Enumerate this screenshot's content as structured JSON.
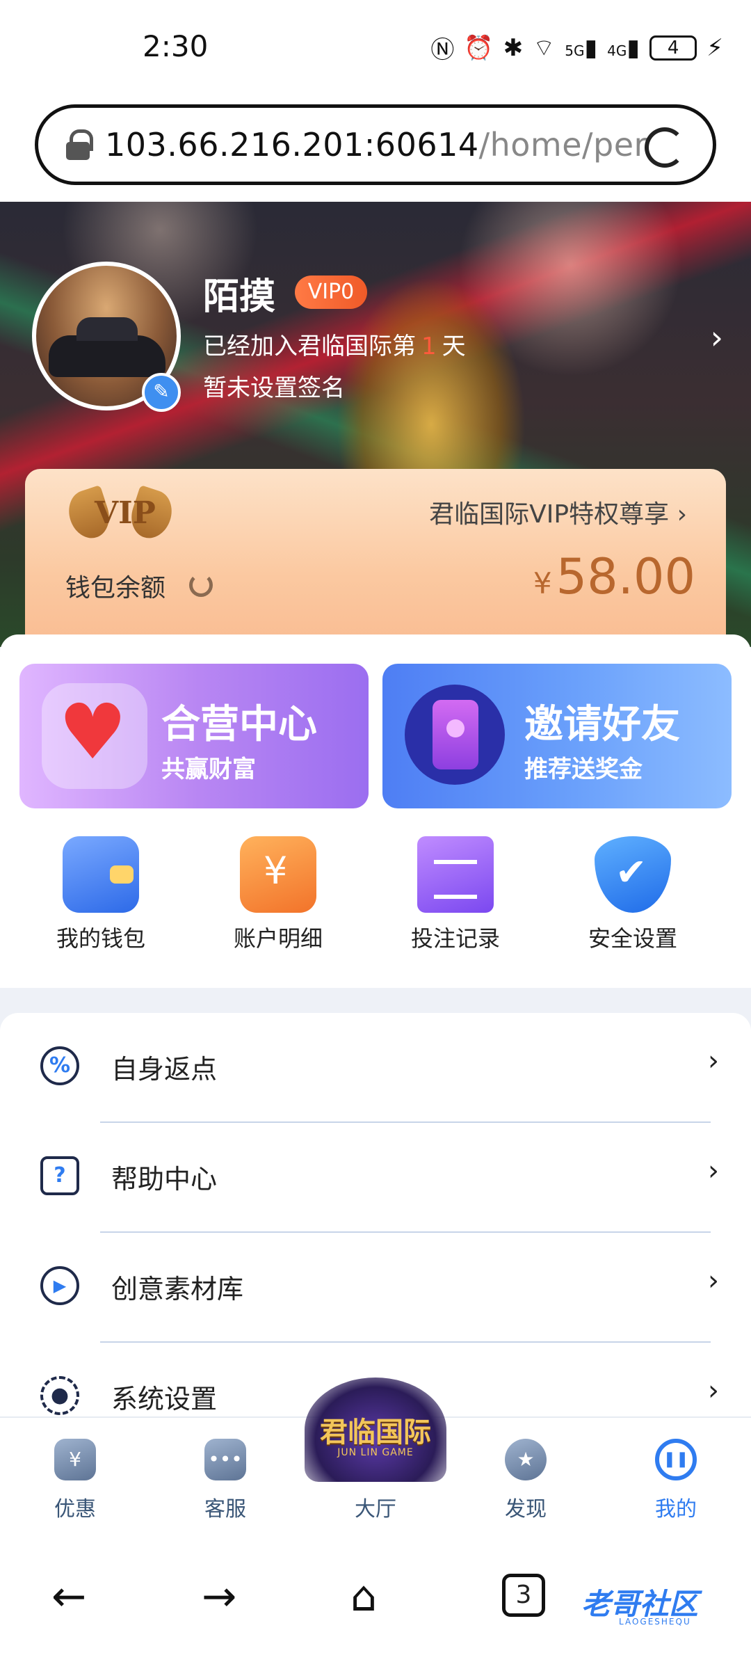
{
  "status_bar": {
    "time": "2:30",
    "icons": [
      "nfc-icon",
      "alarm-icon",
      "bluetooth-icon",
      "wifi-icon",
      "signal-5g-icon",
      "signal-4g-icon",
      "battery-icon",
      "charging-icon"
    ],
    "battery_level": "4",
    "network_5g": "5G",
    "network_4g": "4G"
  },
  "browser": {
    "url_host": "103.66.216.201:60614",
    "url_path": "/home/pers"
  },
  "profile": {
    "username": "陌摸",
    "vip_level": "VIP0",
    "joined_prefix": "已经加入君临国际第",
    "joined_days": "1",
    "joined_suffix": "天",
    "signature": "暂未设置签名"
  },
  "vip_card": {
    "logo_text": "VIP",
    "privilege_text": "君临国际VIP特权尊享",
    "wallet_label": "钱包余额",
    "currency": "¥",
    "balance": "58.00"
  },
  "promos": [
    {
      "title": "合营中心",
      "subtitle": "共赢财富"
    },
    {
      "title": "邀请好友",
      "subtitle": "推荐送奖金"
    }
  ],
  "quick_actions": [
    {
      "label": "我的钱包",
      "icon": "wallet-icon"
    },
    {
      "label": "账户明细",
      "icon": "ledger-icon"
    },
    {
      "label": "投注记录",
      "icon": "notepad-icon"
    },
    {
      "label": "安全设置",
      "icon": "shield-icon"
    }
  ],
  "menu": [
    {
      "label": "自身返点",
      "icon": "percent-icon"
    },
    {
      "label": "帮助中心",
      "icon": "question-icon"
    },
    {
      "label": "创意素材库",
      "icon": "play-icon"
    },
    {
      "label": "系统设置",
      "icon": "gear-icon"
    }
  ],
  "app_nav": [
    {
      "label": "优惠",
      "icon": "coupon-icon"
    },
    {
      "label": "客服",
      "icon": "chat-icon"
    },
    {
      "label": "大厅",
      "icon": "hall-emblem-icon"
    },
    {
      "label": "发现",
      "icon": "medal-icon"
    },
    {
      "label": "我的",
      "icon": "profile-icon",
      "active": true
    }
  ],
  "hall_emblem": {
    "text": "君临国际",
    "subtext": "JUN LIN GAME"
  },
  "system_nav": {
    "tab_count": "3",
    "watermark": "老哥社区",
    "watermark_sub": "LAOGESHEQU"
  },
  "colors": {
    "accent": "#2f7cf0",
    "vip_badge": "#f05a28",
    "balance": "#b8672e",
    "days_highlight": "#ff5a3c"
  }
}
